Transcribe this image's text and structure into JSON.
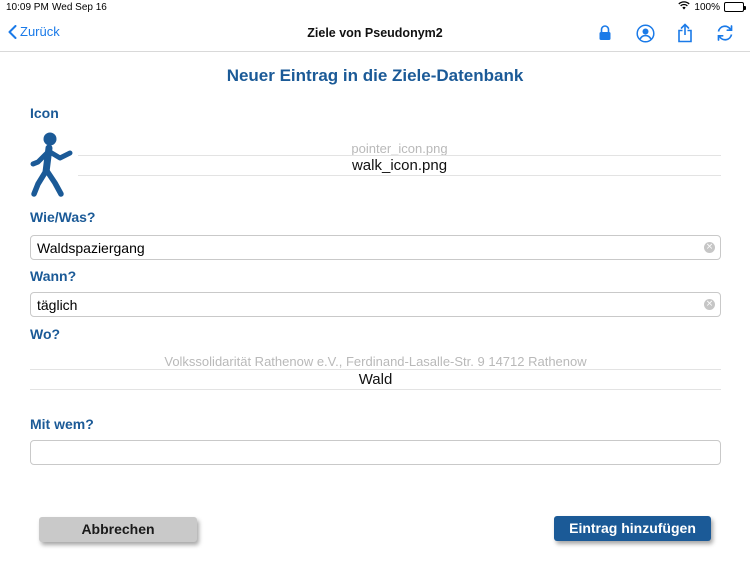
{
  "status_bar": {
    "time": "10:09 PM",
    "date": "Wed Sep 16",
    "battery": "100%"
  },
  "nav": {
    "back_label": "Zurück",
    "title": "Ziele von Pseudonym2",
    "icons": [
      "lock-icon",
      "user-circle-icon",
      "share-icon",
      "refresh-icon"
    ]
  },
  "page_title": "Neuer Eintrag in die Ziele-Datenbank",
  "icon_section": {
    "label": "Icon",
    "picker_options": [
      "pointer_icon.png",
      "walk_icon.png"
    ],
    "selected": "walk_icon.png",
    "figure": "walk-figure-icon"
  },
  "what": {
    "label": "Wie/Was?",
    "value": "Waldspaziergang"
  },
  "when": {
    "label": "Wann?",
    "value": "täglich"
  },
  "where": {
    "label": "Wo?",
    "picker_options": [
      "Volkssolidarität Rathenow e.V., Ferdinand-Lasalle-Str. 9 14712 Rathenow",
      "Wald"
    ],
    "selected": "Wald"
  },
  "with_whom": {
    "label": "Mit wem?",
    "value": ""
  },
  "buttons": {
    "cancel": "Abbrechen",
    "add": "Eintrag hinzufügen"
  },
  "colors": {
    "accent": "#1b5a97",
    "link": "#1a7ae8",
    "cancel_bg": "#c9c9c9"
  }
}
